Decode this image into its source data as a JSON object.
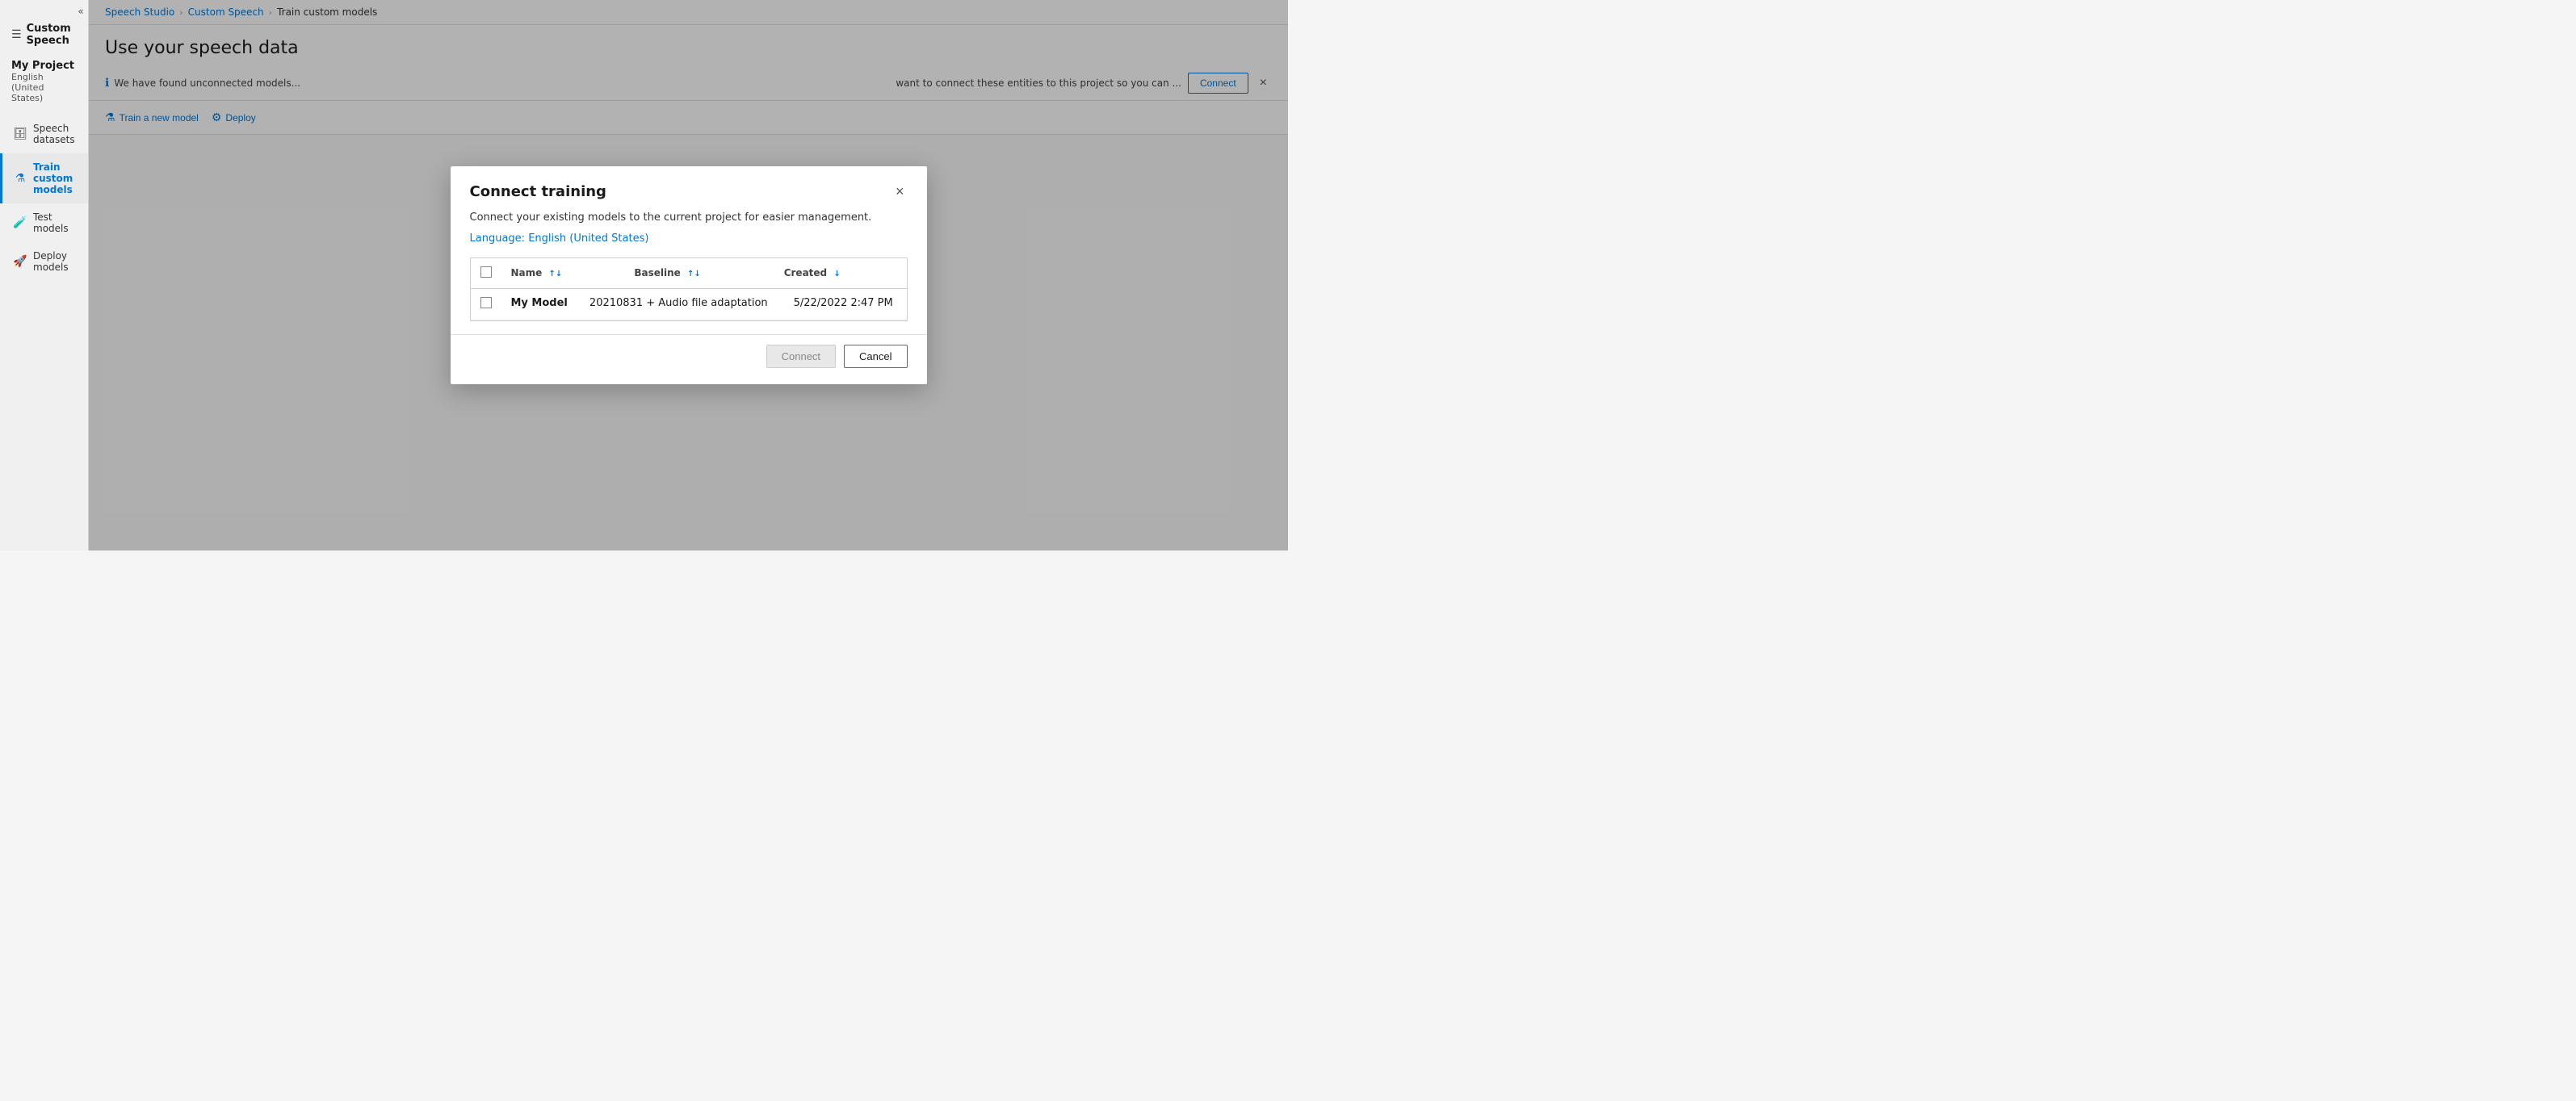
{
  "app": {
    "title": "Custom Speech",
    "hamburger": "☰"
  },
  "sidebar": {
    "collapse_icon": "«",
    "project_name": "My Project",
    "project_lang": "English (United States)",
    "nav_items": [
      {
        "id": "speech-datasets",
        "label": "Speech datasets",
        "icon": "🗄",
        "active": false
      },
      {
        "id": "train-custom-models",
        "label": "Train custom models",
        "icon": "⚗",
        "active": true
      },
      {
        "id": "test-models",
        "label": "Test models",
        "icon": "🧪",
        "active": false
      },
      {
        "id": "deploy-models",
        "label": "Deploy models",
        "icon": "🚀",
        "active": false
      }
    ]
  },
  "breadcrumb": {
    "items": [
      "Speech Studio",
      "Custom Speech",
      "Train custom models"
    ]
  },
  "page": {
    "title": "Use your speech data",
    "info_bar_text": "We have found unconnected models...",
    "info_bar_suffix": "want to connect these entities to this project so you can ...",
    "connect_button": "Connect",
    "dismiss_aria": "×"
  },
  "toolbar": {
    "train_button": "Train a new model",
    "deploy_button": "Deploy",
    "train_icon": "⚗",
    "deploy_icon": "⚙"
  },
  "modal": {
    "title": "Connect training",
    "close_aria": "×",
    "description_text": "Connect your existing models to the current project for easier management.",
    "description_link": "",
    "language_label": "Language:",
    "language_value": "English (United States)",
    "table": {
      "columns": [
        {
          "id": "name",
          "label": "Name",
          "sort_icon": "↑↓"
        },
        {
          "id": "baseline",
          "label": "Baseline",
          "sort_icon": "↑↓"
        },
        {
          "id": "created",
          "label": "Created",
          "sort_icon": "↓"
        }
      ],
      "rows": [
        {
          "checked": false,
          "name": "My Model",
          "baseline": "20210831 + Audio file adaptation",
          "created": "5/22/2022 2:47 PM"
        }
      ]
    },
    "footer": {
      "connect_btn": "Connect",
      "cancel_btn": "Cancel"
    }
  },
  "colors": {
    "accent": "#0078d4",
    "active_nav": "#0078d4"
  }
}
